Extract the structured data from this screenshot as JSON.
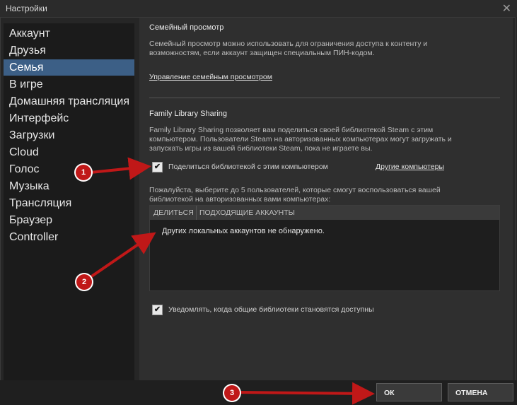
{
  "window": {
    "title": "Настройки",
    "close_glyph": "✕"
  },
  "sidebar": {
    "items": [
      {
        "label": "Аккаунт"
      },
      {
        "label": "Друзья"
      },
      {
        "label": "Семья",
        "active": true
      },
      {
        "label": "В игре"
      },
      {
        "label": "Домашняя трансляция"
      },
      {
        "label": "Интерфейс"
      },
      {
        "label": "Загрузки"
      },
      {
        "label": "Cloud"
      },
      {
        "label": "Голос"
      },
      {
        "label": "Музыка"
      },
      {
        "label": "Трансляция"
      },
      {
        "label": "Браузер"
      },
      {
        "label": "Controller"
      }
    ]
  },
  "family_view": {
    "heading": "Семейный просмотр",
    "description_line1": "Семейный просмотр можно использовать для ограничения доступа к контенту и",
    "description_line2": "возможностям, если аккаунт защищен специальным ПИН-кодом.",
    "manage_link": "Управление семейным просмотром"
  },
  "library_sharing": {
    "heading": "Family Library Sharing",
    "description_line1": "Family Library Sharing позволяет вам поделиться своей библиотекой Steam с этим",
    "description_line2": "компьютером. Пользователи Steam на авторизованных компьютерах могут загружать и",
    "description_line3": "запускать игры из вашей библиотеки Steam, пока не играете вы.",
    "share_checkbox_label": "Поделиться библиотекой с этим компьютером",
    "share_checked": true,
    "other_computers_link": "Другие компьютеры",
    "select_users_line1": "Пожалуйста, выберите до 5 пользователей, которые смогут воспользоваться вашей",
    "select_users_line2": "библиотекой на авторизованных вами компьютерах:",
    "table_columns": [
      "ДЕЛИТЬСЯ",
      "ПОДХОДЯЩИЕ АККАУНТЫ"
    ],
    "empty_message": "Других локальных аккаунтов не обнаружено.",
    "notify_checkbox_label": "Уведомлять, когда общие библиотеки становятся доступны",
    "notify_checked": true
  },
  "buttons": {
    "ok_label": "ОК",
    "cancel_label": "ОТМЕНА"
  },
  "annotations": {
    "badge_1": "1",
    "badge_2": "2",
    "badge_3": "3"
  },
  "colors": {
    "accent_active": "#3c5f86",
    "annotation_red": "#c01818"
  }
}
